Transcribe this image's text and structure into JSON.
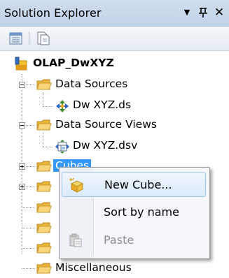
{
  "panel": {
    "title": "Solution Explorer",
    "dropdown_glyph": "▼",
    "pin_glyph": "ꟸ",
    "close_glyph": "✕"
  },
  "toolbar": {
    "properties_icon": "properties-icon",
    "show_all_files_icon": "show-all-files-icon"
  },
  "tree": {
    "root": {
      "label": "OLAP_DwXYZ",
      "icon": "project-icon"
    },
    "nodes": [
      {
        "label": "Data Sources",
        "icon": "folder-icon",
        "expanded": true
      },
      {
        "label": "Dw XYZ.ds",
        "icon": "data-source-icon"
      },
      {
        "label": "Data Source Views",
        "icon": "folder-icon",
        "expanded": true
      },
      {
        "label": "Dw XYZ.dsv",
        "icon": "data-source-view-icon"
      },
      {
        "label": "Cubes",
        "icon": "folder-icon",
        "expanded": false,
        "selected": true
      },
      {
        "label": "",
        "icon": "folder-icon",
        "expanded": false
      },
      {
        "label": "",
        "icon": "folder-icon"
      },
      {
        "label": "",
        "icon": "folder-icon"
      },
      {
        "label": "",
        "icon": "folder-icon"
      },
      {
        "label": "Miscellaneous",
        "icon": "folder-icon"
      }
    ]
  },
  "context_menu": {
    "items": [
      {
        "label": "New Cube...",
        "icon": "new-cube-icon",
        "enabled": true,
        "highlighted": true
      },
      {
        "label": "Sort by name",
        "icon": "",
        "enabled": true
      },
      {
        "label": "Paste",
        "icon": "paste-icon",
        "enabled": false
      }
    ]
  },
  "colors": {
    "selection": "#3399ff",
    "title_bar": "#c8d8eb",
    "folder": "#f3c74f"
  }
}
